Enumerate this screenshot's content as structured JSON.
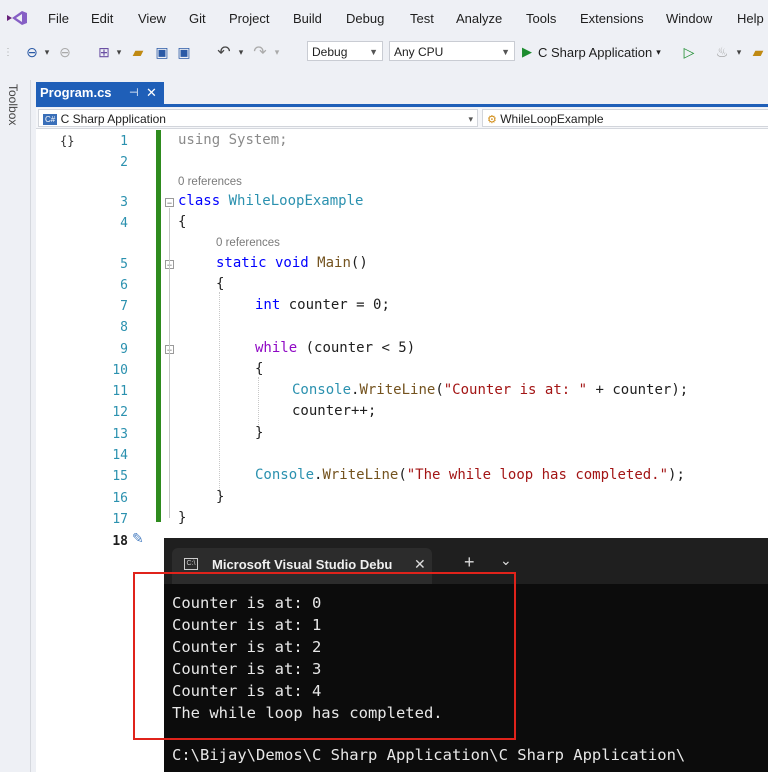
{
  "menu": [
    "File",
    "Edit",
    "View",
    "Git",
    "Project",
    "Build",
    "Debug",
    "Test",
    "Analyze",
    "Tools",
    "Extensions",
    "Window",
    "Help"
  ],
  "toolbar": {
    "config": "Debug",
    "platform": "Any CPU",
    "run_label": "C Sharp Application"
  },
  "toolbox_label": "Toolbox",
  "tab": {
    "label": "Program.cs",
    "pin": "⊣",
    "close": "✕"
  },
  "nav": {
    "project": "C Sharp Application",
    "class": "WhileLoopExample"
  },
  "code": {
    "lines": [
      "1",
      "2",
      "3",
      "4",
      "5",
      "6",
      "7",
      "8",
      "9",
      "10",
      "11",
      "12",
      "13",
      "14",
      "15",
      "16",
      "17",
      "18"
    ],
    "refs": "0 references",
    "l1_using": "using",
    "l1_ns": " System;",
    "l3_kw": "class",
    "l3_name": " WhileLoopExample",
    "l4": "{",
    "l5_kw1": "static",
    "l5_kw2": " void",
    "l5_name": " Main",
    "l5_rest": "()",
    "l6": "{",
    "l7_kw": "int",
    "l7_rest": " counter = 0;",
    "l9_kw": "while",
    "l9_rest": " (counter < 5)",
    "l10": "{",
    "l11_type": "Console",
    "l11_dot": ".",
    "l11_method": "WriteLine",
    "l11_open": "(",
    "l11_str": "\"Counter is at: \"",
    "l11_rest": " + counter);",
    "l12": "counter++;",
    "l13": "}",
    "l15_type": "Console",
    "l15_dot": ".",
    "l15_method": "WriteLine",
    "l15_open": "(",
    "l15_str": "\"The while loop has completed.\"",
    "l15_rest": ");",
    "l16": "}",
    "l17": "}"
  },
  "console": {
    "tab_title": "Microsoft Visual Studio Debu",
    "close": "✕",
    "add": "+",
    "more": "⌄",
    "output": [
      "Counter is at: 0",
      "Counter is at: 1",
      "Counter is at: 2",
      "Counter is at: 3",
      "Counter is at: 4",
      "The while loop has completed."
    ],
    "path": "C:\\Bijay\\Demos\\C Sharp Application\\C Sharp Application\\"
  },
  "colors": {
    "accent": "#1f5fb8",
    "highlight_box": "#e0231b",
    "change_bar": "#2e8b1e"
  }
}
